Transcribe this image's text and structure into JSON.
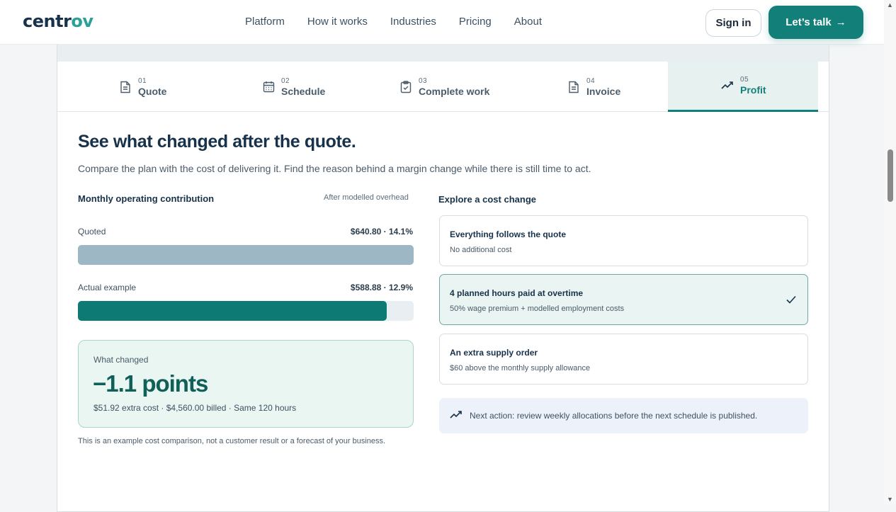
{
  "header": {
    "logo_main": "centr",
    "logo_accent": "ov",
    "nav": [
      "Platform",
      "How it works",
      "Industries",
      "Pricing",
      "About"
    ],
    "signin_label": "Sign in",
    "cta_label": "Let’s talk",
    "cta_arrow": "→"
  },
  "tabs": [
    {
      "num": "01",
      "label": "Quote",
      "icon": "document-icon"
    },
    {
      "num": "02",
      "label": "Schedule",
      "icon": "calendar-icon"
    },
    {
      "num": "03",
      "label": "Complete work",
      "icon": "clipboard-check-icon"
    },
    {
      "num": "04",
      "label": "Invoice",
      "icon": "document-icon"
    },
    {
      "num": "05",
      "label": "Profit",
      "icon": "trending-up-icon",
      "active": true
    }
  ],
  "main": {
    "headline": "See what changed after the quote.",
    "subtitle": "Compare the plan with the cost of delivering it. Find the reason behind a margin change while there is still time to act."
  },
  "contribution": {
    "heading": "Monthly operating contribution",
    "note": "After modelled overhead",
    "bars": [
      {
        "label": "Quoted",
        "value_text": "$640.80 · 14.1%",
        "fraction": 1.0,
        "color": "#9db8c4"
      },
      {
        "label": "Actual example",
        "value_text": "$588.88 · 12.9%",
        "fraction": 0.919,
        "color": "#0d7b74"
      }
    ],
    "changed": {
      "label": "What changed",
      "value": "−1.1 points",
      "details": "$51.92 extra cost · $4,560.00 billed · Same 120 hours"
    },
    "disclaimer": "This is an example cost comparison, not a customer result or a forecast of your business."
  },
  "explore": {
    "heading": "Explore a cost change",
    "options": [
      {
        "title": "Everything follows the quote",
        "desc": "No additional cost",
        "selected": false
      },
      {
        "title": "4 planned hours paid at overtime",
        "desc": "50% wage premium + modelled employment costs",
        "selected": true
      },
      {
        "title": "An extra supply order",
        "desc": "$60 above the monthly supply allowance",
        "selected": false
      }
    ],
    "next_action": "Next action: review weekly allocations before the next schedule is published."
  },
  "colors": {
    "accent": "#137f79",
    "brand": "#17324a"
  }
}
